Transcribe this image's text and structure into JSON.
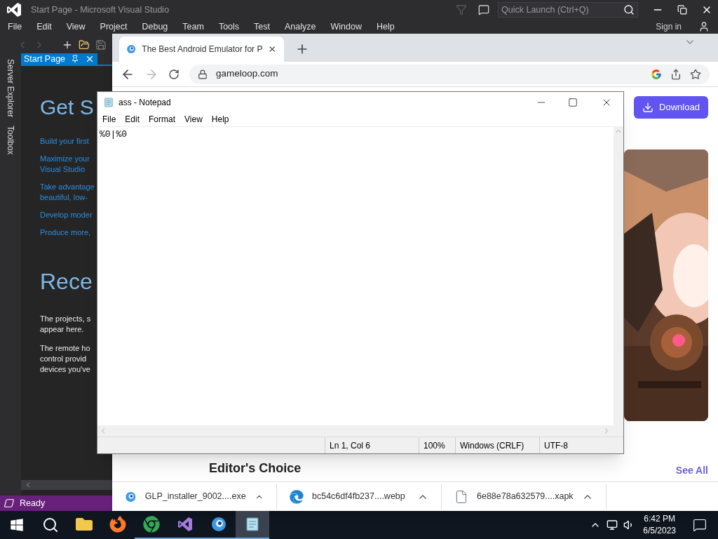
{
  "visual_studio": {
    "title": "Start Page - Microsoft Visual Studio",
    "quick_launch": {
      "placeholder": "Quick Launch (Ctrl+Q)"
    },
    "menu": [
      "File",
      "Edit",
      "View",
      "Project",
      "Debug",
      "Team",
      "Tools",
      "Test",
      "Analyze",
      "Window",
      "Help"
    ],
    "sign_in": "Sign in",
    "side_tabs": [
      "Server Explorer",
      "Toolbox"
    ],
    "document_tab": "Start Page",
    "heading_1": "Get S",
    "links": [
      [
        "Build your first"
      ],
      [
        "Maximize your",
        "Visual Studio"
      ],
      [
        "Take advantage",
        "beautiful, low-"
      ],
      [
        "Develop moder"
      ],
      [
        "Produce more,"
      ]
    ],
    "heading_2": "Rece",
    "paragraphs": [
      [
        "The projects, s",
        "appear here."
      ],
      [
        "The remote ho",
        "control provid",
        "devices you've"
      ]
    ],
    "status": "Ready"
  },
  "browser": {
    "tab_title": "The Best Android Emulator for P",
    "address": "gameloop.com",
    "download_button": "Download",
    "section_title": "Editor's Choice",
    "see_all": "See All",
    "downloads": [
      {
        "name": "GLP_installer_9002....exe",
        "kind": "app"
      },
      {
        "name": "bc54c6df4fb237....webp",
        "kind": "browser"
      },
      {
        "name": "6e88e78a632579....xapk",
        "kind": "file"
      }
    ]
  },
  "notepad": {
    "title": "ass - Notepad",
    "menu": [
      "File",
      "Edit",
      "Format",
      "View",
      "Help"
    ],
    "text": "%0|%0",
    "status": [
      "Ln 1, Col 6",
      "100%",
      "Windows (CRLF)",
      "UTF-8"
    ]
  },
  "taskbar": {
    "apps": [
      {
        "kind": "folder",
        "running": false,
        "selected": false
      },
      {
        "kind": "fox",
        "running": false,
        "selected": false
      },
      {
        "kind": "chrome",
        "running": true,
        "selected": false
      },
      {
        "kind": "studio",
        "running": true,
        "selected": false
      },
      {
        "kind": "emulator",
        "running": true,
        "selected": false
      },
      {
        "kind": "notepad",
        "running": true,
        "selected": true
      }
    ],
    "time": "6:42 PM",
    "date": "6/5/2023"
  }
}
